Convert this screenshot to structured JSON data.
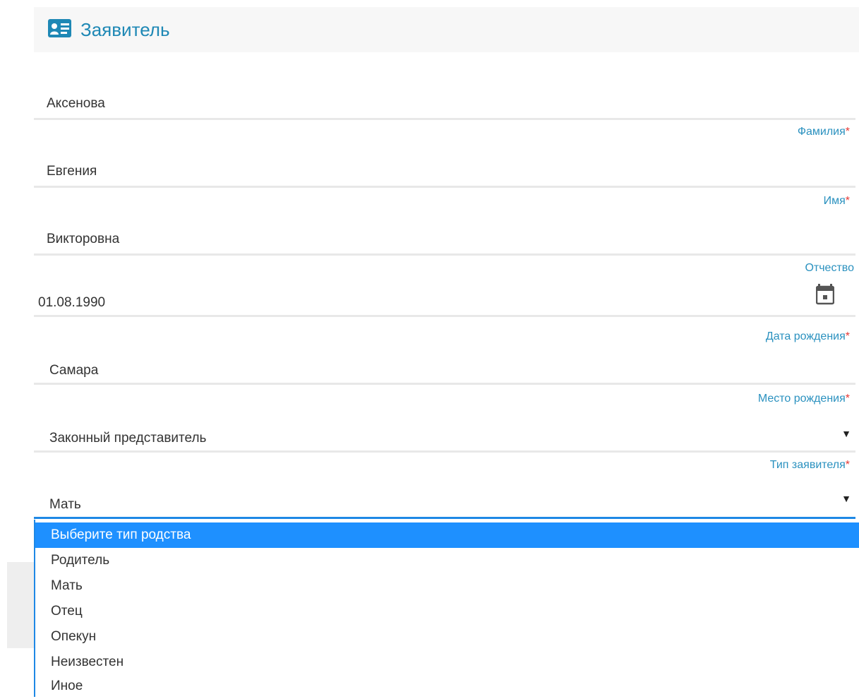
{
  "section": {
    "title": "Заявитель",
    "icon": "id-card-icon",
    "accent_color": "#1e88b5"
  },
  "fields": {
    "last_name": {
      "value": "Аксенова",
      "label": "Фамилия",
      "required_mark": "*"
    },
    "first_name": {
      "value": "Евгения",
      "label": "Имя",
      "required_mark": "*"
    },
    "patronymic": {
      "value": "Викторовна",
      "label": "Отчество"
    },
    "birth_date": {
      "value": "01.08.1990",
      "label": "Дата рождения",
      "required_mark": "*",
      "icon": "calendar-icon"
    },
    "birth_place": {
      "value": "Самара",
      "label": "Место рождения",
      "required_mark": "*"
    },
    "applicant_type": {
      "value": "Законный представитель",
      "label": "Тип заявителя",
      "required_mark": "*",
      "icon": "caret-down-icon"
    },
    "relation_type": {
      "value": "Мать",
      "icon": "caret-down-icon"
    }
  },
  "relation_dropdown": {
    "highlight_color": "#1e90ff",
    "options": [
      "Выберите тип родства",
      "Родитель",
      "Мать",
      "Отец",
      "Опекун",
      "Неизвестен",
      "Иное"
    ]
  },
  "glyphs": {
    "caret": "▼"
  }
}
